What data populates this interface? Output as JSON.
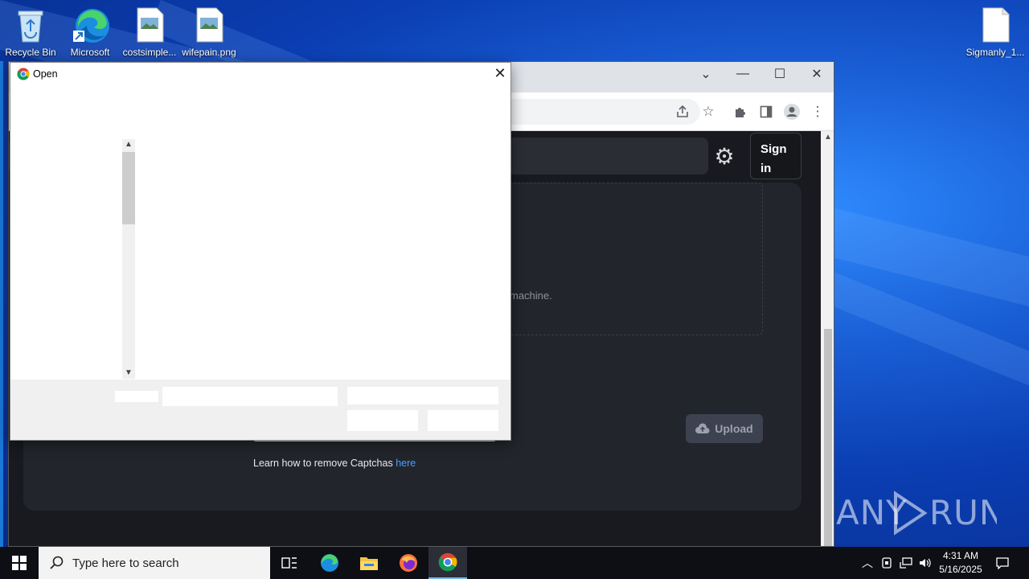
{
  "desktop": {
    "icons": [
      {
        "label": "Recycle Bin",
        "icon": "recycle-bin-icon"
      },
      {
        "label": "Microsoft",
        "icon": "edge-icon"
      },
      {
        "label": "costsimple...",
        "icon": "image-file-icon"
      },
      {
        "label": "wifepain.png",
        "icon": "image-file-icon"
      },
      {
        "label": "Sigmanly_1...",
        "icon": "blank-file-icon"
      }
    ],
    "watermark": "ANY RUN"
  },
  "browser": {
    "window_controls": {
      "minimize": "—",
      "maximize": "☐",
      "close": "✕",
      "tab_search": "⌄"
    },
    "page": {
      "signin_label": "Sign in",
      "dropzone_text": "machine.",
      "upload_label": "Upload",
      "captcha_text": "Learn how to remove Captchas ",
      "captcha_link": "here"
    }
  },
  "dialog": {
    "title": "Open",
    "close": "✕"
  },
  "taskbar": {
    "search_placeholder": "Type here to search",
    "time": "4:31 AM",
    "date": "5/16/2025"
  },
  "colors": {
    "accent_link": "#4a9eff",
    "page_bg": "#181a1f",
    "card_bg": "#22252b",
    "taskbar_bg": "#0d0f14"
  }
}
